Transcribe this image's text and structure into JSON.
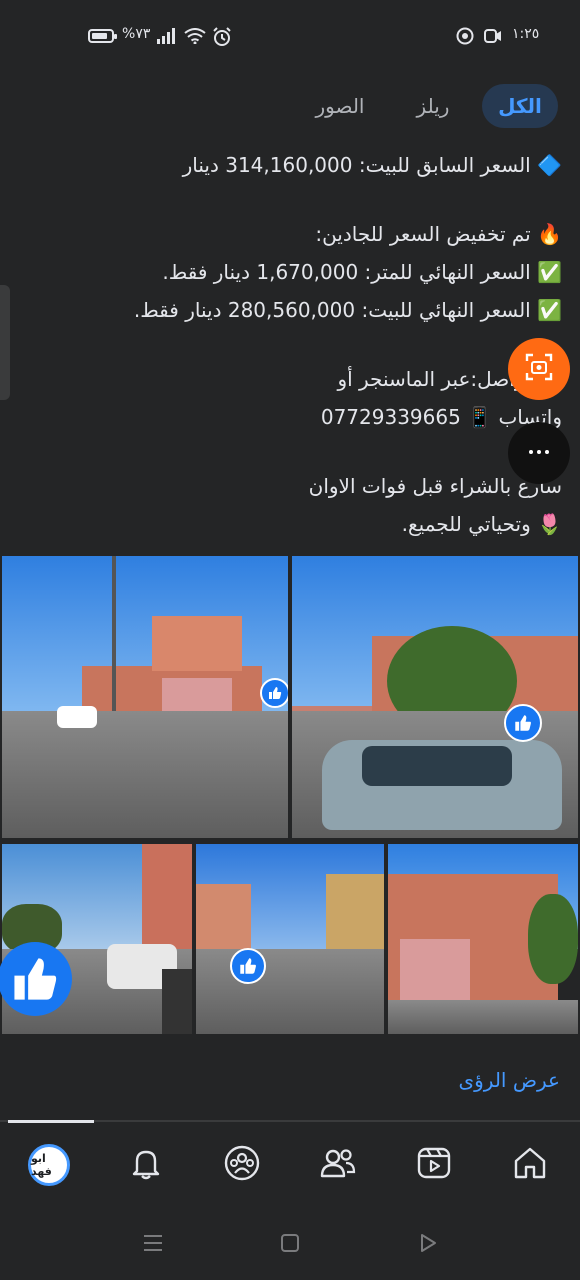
{
  "status_bar": {
    "time": "١:٢٥",
    "battery": "%٧٣"
  },
  "tabs": [
    {
      "label": "الكل",
      "active": true
    },
    {
      "label": "ريلز",
      "active": false
    },
    {
      "label": "الصور",
      "active": false
    }
  ],
  "post": {
    "lines": [
      "🔷 السعر السابق للبيت: 314,160,000 دينار",
      "",
      "🔥 تم تخفيض السعر للجادين:",
      "✅ السعر النهائي للمتر: 1,670,000 دينار فقط.",
      "✅ السعر النهائي للبيت: 280,560,000 دينار فقط.",
      "",
      "📞 تواصل:عبر الماسنجر أو",
      "واتساب 📱 07729339665",
      "",
      "سارع بالشراء قبل فوات الاوان",
      "🌷 وتحياتي للجميع."
    ]
  },
  "photos_count": 5,
  "see_insights": "عرض الرؤى",
  "profile": {
    "avatar_text": "ابو فهد"
  },
  "nav": {
    "items": [
      "profile-icon",
      "bell-icon",
      "groups-icon",
      "friends-icon",
      "video-icon",
      "home-icon"
    ]
  },
  "colors": {
    "background": "#242526",
    "accent": "#4599ff",
    "like_blue": "#1877f2",
    "floating_orange": "#ff6a13"
  }
}
